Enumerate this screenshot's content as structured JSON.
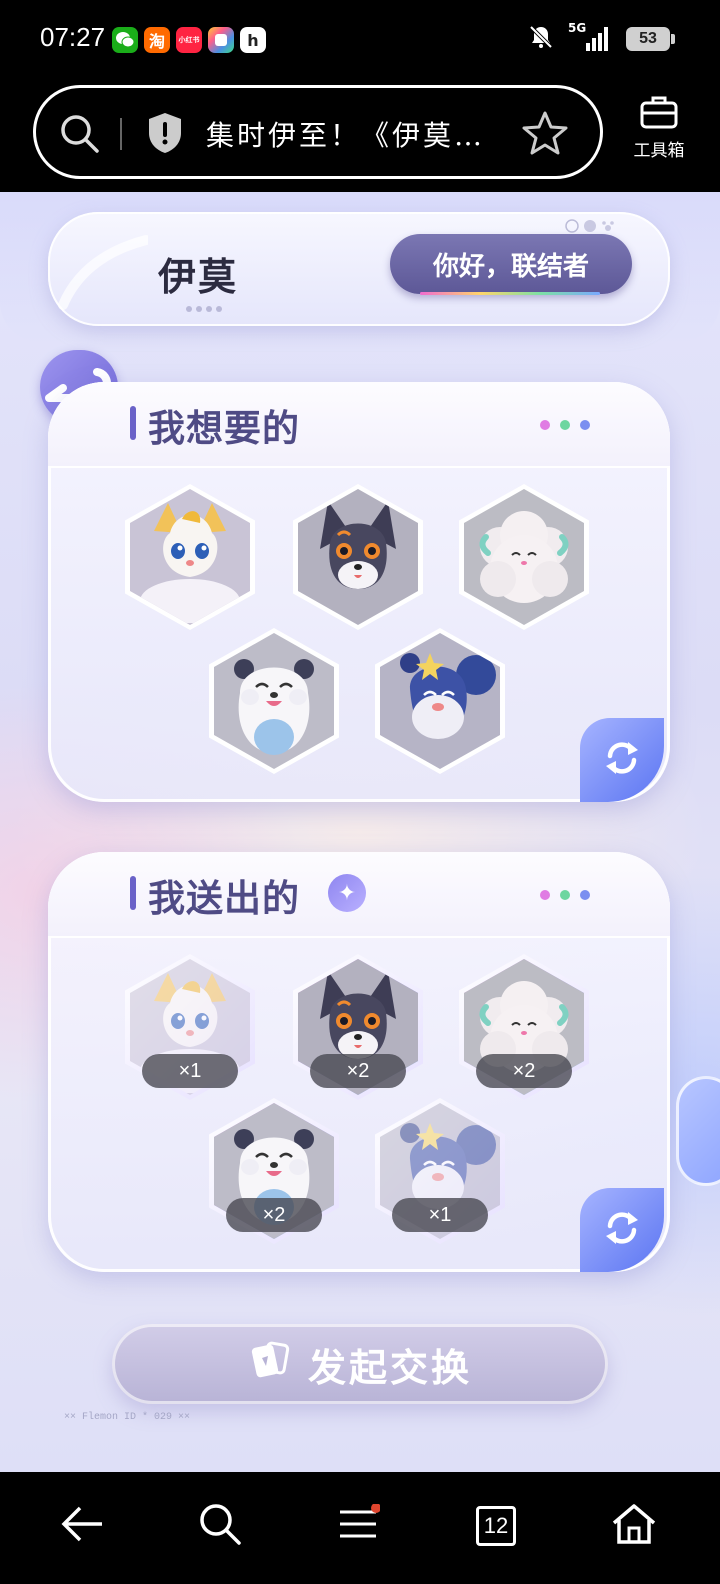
{
  "status": {
    "time": "07:27",
    "network": "5G",
    "battery": "53",
    "apps": [
      {
        "name": "wechat-icon",
        "color": "#1aad19",
        "glyph": ""
      },
      {
        "name": "taobao-icon",
        "color": "#ff6a00",
        "glyph": "淘"
      },
      {
        "name": "xiaohongshu-icon",
        "color": "#ff2442",
        "glyph": "小红书"
      },
      {
        "name": "gallery-icon",
        "color": "#4a90e2",
        "glyph": ""
      },
      {
        "name": "h-app-icon",
        "color": "#ffffff",
        "glyph": "h"
      }
    ]
  },
  "browser": {
    "url_text": "集时伊至！《伊莫…",
    "toolbox_label": "工具箱"
  },
  "header": {
    "logo": "伊莫",
    "greeting": "你好，联结者"
  },
  "want_panel": {
    "title": "我想要的",
    "items": [
      {
        "name": "creature-orange-fox"
      },
      {
        "name": "creature-dark-fox"
      },
      {
        "name": "creature-white-sheep"
      },
      {
        "name": "creature-white-bear"
      },
      {
        "name": "creature-blue-squirrel"
      }
    ]
  },
  "give_panel": {
    "title": "我送出的",
    "items": [
      {
        "name": "creature-orange-fox",
        "count": "×1",
        "faded": true
      },
      {
        "name": "creature-dark-fox",
        "count": "×2",
        "faded": false
      },
      {
        "name": "creature-white-sheep",
        "count": "×2",
        "faded": false
      },
      {
        "name": "creature-white-bear",
        "count": "×2",
        "faded": false
      },
      {
        "name": "creature-blue-squirrel",
        "count": "×1",
        "faded": true
      }
    ]
  },
  "action": {
    "label": "发起交换"
  },
  "footer": {
    "meta": "×× Flemon ID * 029 ××"
  },
  "nav": {
    "tab_count": "12"
  },
  "colors": {
    "accent": "#6a62c8",
    "title": "#4f4b85",
    "dot_pink": "#e07ce3",
    "dot_green": "#6ed6a0",
    "dot_blue": "#7b8ff0"
  }
}
